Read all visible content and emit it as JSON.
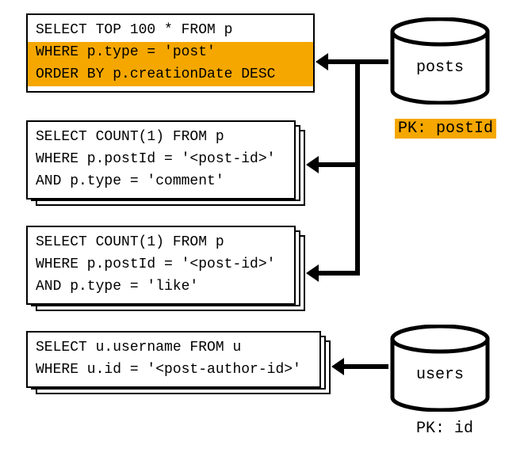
{
  "queries": {
    "q1": {
      "line1": "SELECT TOP 100 * FROM p",
      "line2": "WHERE p.type = 'post'",
      "line3": "ORDER BY p.creationDate DESC"
    },
    "q2": {
      "line1": "SELECT COUNT(1) FROM p",
      "line2": "WHERE p.postId = '<post-id>'",
      "line3": "AND p.type = 'comment'"
    },
    "q3": {
      "line1": "SELECT COUNT(1) FROM p",
      "line2": "WHERE p.postId = '<post-id>'",
      "line3": "AND p.type = 'like'"
    },
    "q4": {
      "line1": "SELECT u.username FROM u",
      "line2": "WHERE u.id = '<post-author-id>'"
    }
  },
  "databases": {
    "posts": {
      "label": "posts",
      "pk": "PK: postId"
    },
    "users": {
      "label": "users",
      "pk": "PK: id"
    }
  }
}
